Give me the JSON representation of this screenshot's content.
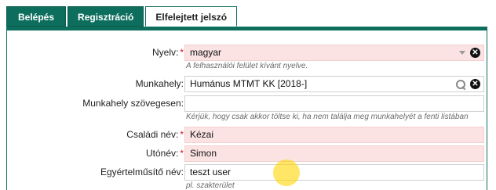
{
  "tabs": [
    {
      "label": "Belépés"
    },
    {
      "label": "Regisztráció"
    },
    {
      "label": "Elfelejtett jelszó"
    }
  ],
  "form": {
    "language": {
      "label": "Nyelv:",
      "value": "magyar",
      "hint": "A felhasználói felület kívánt nyelve."
    },
    "workplace": {
      "label": "Munkahely:",
      "value": "Humánus MTMT KK [2018-]"
    },
    "workplace_text": {
      "label": "Munkahely szövegesen:",
      "value": "",
      "hint": "Kérjük, hogy csak akkor töltse ki, ha nem találja meg munkahelyét a fenti listában"
    },
    "family_name": {
      "label": "Családi név:",
      "value": "Kézai"
    },
    "given_name": {
      "label": "Utónév:",
      "value": "Simon"
    },
    "unique_name": {
      "label": "Egyértelműsítő név:",
      "value": "teszt user",
      "hint": "pl. szakterület"
    }
  },
  "required_marker": "*",
  "colors": {
    "accent": "#0e6e5e",
    "required_bg": "#fbe3e3",
    "required_marker": "#d2161c"
  }
}
